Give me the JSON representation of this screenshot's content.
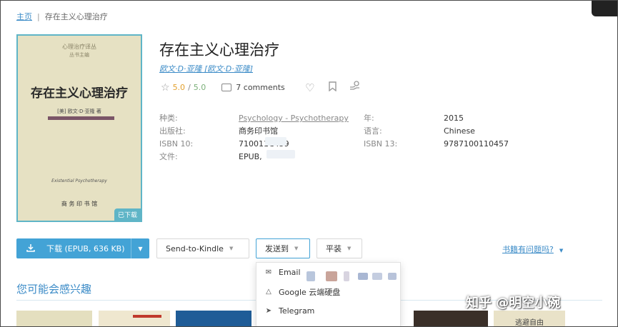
{
  "breadcrumb": {
    "home": "主页",
    "separator": "|",
    "current": "存在主义心理治疗"
  },
  "cover": {
    "series": "心理治疗译丛",
    "editor": "丛书主编",
    "title": "存在主义心理治疗",
    "author": "[美] 欧文·D·亚隆 著",
    "english_title": "Existential Psychotherapy",
    "publisher_mark": "商 务 印 书 馆",
    "downloaded_badge": "已下载"
  },
  "book": {
    "title": "存在主义心理治疗",
    "authors": "欧文·D·亚隆 [欧文·D·亚隆]",
    "rating_1": "5.0",
    "rating_sep": "/",
    "rating_2": "5.0",
    "comments": "7 comments"
  },
  "details": {
    "category_label": "种类:",
    "category_value": "Psychology - Psychotherapy",
    "publisher_label": "出版社:",
    "publisher_value": "商务印书馆",
    "isbn10_label": "ISBN 10:",
    "isbn10_value": "710011C459",
    "file_label": "文件:",
    "file_value": "EPUB,",
    "year_label": "年:",
    "year_value": "2015",
    "language_label": "语言:",
    "language_value": "Chinese",
    "isbn13_label": "ISBN 13:",
    "isbn13_value": "9787100110457"
  },
  "actions": {
    "download": "下载 (EPUB, 636 KB)",
    "send_to_kindle": "Send-to-Kindle",
    "send_to": "发送到",
    "paperback": "平装",
    "issue": "书籍有问题吗?"
  },
  "send_menu": {
    "email": "Email",
    "google_drive": "Google 云端硬盘",
    "telegram": "Telegram"
  },
  "recommend": {
    "title": "您可能会感兴趣"
  },
  "thumb_texts": {
    "t5": "逃避自由"
  },
  "watermark": "知乎 @明空小碗",
  "colors": {
    "accent": "#43a3d6",
    "link": "#3b8bc7",
    "rating": "#e3a12f"
  }
}
